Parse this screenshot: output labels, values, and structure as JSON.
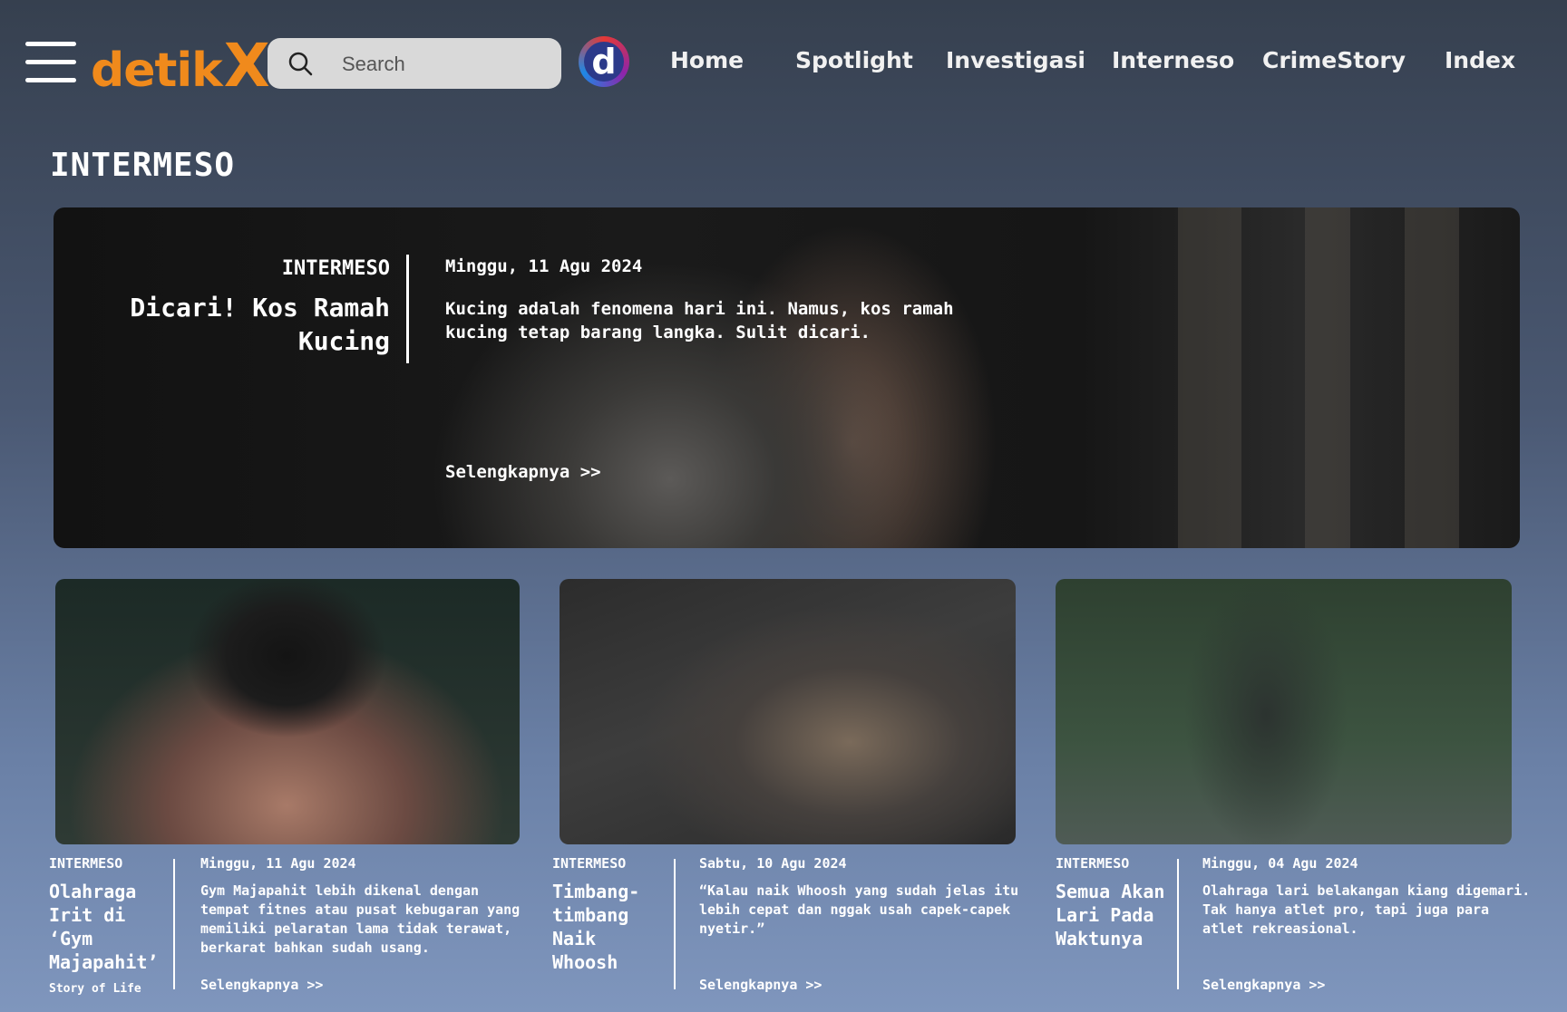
{
  "header": {
    "logo_part1": "detik",
    "logo_part2": "X",
    "search_placeholder": "Search",
    "d_logo": "d",
    "nav": [
      "Home",
      "Spotlight",
      "Investigasi",
      "Interneso",
      "CrimeStory",
      "Index"
    ]
  },
  "section_title": "INTERMESO",
  "hero": {
    "category": "INTERMESO",
    "title": "Dicari! Kos Ramah Kucing",
    "date": "Minggu, 11 Agu 2024",
    "description": "Kucing adalah fenomena hari ini. Namus, kos ramah kucing tetap barang langka. Sulit dicari.",
    "more": "Selengkapnya >>"
  },
  "cards": [
    {
      "category": "INTERMESO",
      "title": "Olahraga Irit di ‘Gym Majapahit’",
      "tag": "Story of Life",
      "date": "Minggu, 11 Agu 2024",
      "description": "Gym Majapahit lebih dikenal dengan tempat fitnes atau pusat kebugaran yang memiliki pelaratan lama tidak terawat, berkarat bahkan sudah usang.",
      "more": "Selengkapnya >>"
    },
    {
      "category": "INTERMESO",
      "title": "Timbang-timbang Naik Whoosh",
      "date": "Sabtu, 10 Agu 2024",
      "description": "“Kalau naik Whoosh yang sudah jelas itu lebih cepat dan nggak usah capek-capek nyetir.”",
      "more": "Selengkapnya >>"
    },
    {
      "category": "INTERMESO",
      "title": "Semua Akan Lari Pada Waktunya",
      "date": "Minggu, 04 Agu 2024",
      "description": "Olahraga lari belakangan kiang digemari. Tak hanya atlet pro, tapi juga para atlet rekreasional.",
      "more": "Selengkapnya >>"
    }
  ],
  "colors": {
    "logo_orange": "#f08a1c",
    "search_bg": "#d9d9d9"
  }
}
